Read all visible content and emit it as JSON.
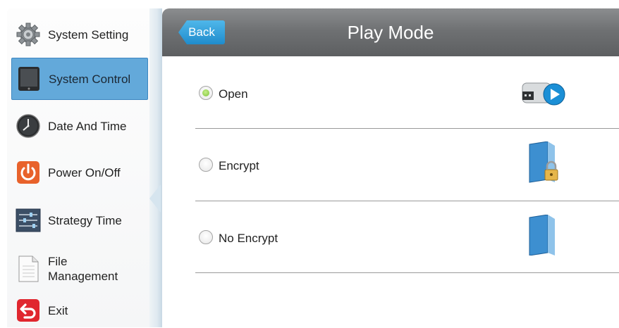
{
  "sidebar": {
    "items": [
      {
        "label": "System Setting",
        "icon": "gear-icon",
        "active": false
      },
      {
        "label": "System Control",
        "icon": "tablet-icon",
        "active": true
      },
      {
        "label": "Date And Time",
        "icon": "clock-icon",
        "active": false
      },
      {
        "label": "Power On/Off",
        "icon": "power-icon",
        "active": false
      },
      {
        "label": "Strategy Time",
        "icon": "sliders-icon",
        "active": false
      },
      {
        "label_line1": "File",
        "label_line2": "Management",
        "icon": "document-icon",
        "active": false
      },
      {
        "label": "Exit",
        "icon": "exit-icon",
        "active": false
      }
    ]
  },
  "header": {
    "back_label": "Back",
    "title": "Play Mode"
  },
  "options": [
    {
      "label": "Open",
      "selected": true,
      "icon": "usb-play-icon"
    },
    {
      "label": "Encrypt",
      "selected": false,
      "icon": "locked-folder-icon"
    },
    {
      "label": "No Encrypt",
      "selected": false,
      "icon": "folder-icon"
    }
  ],
  "colors": {
    "header_gray": "#6f7173",
    "back_blue": "#1f8ccc",
    "active_item_blue": "#63a9da",
    "radio_green": "#7cc238"
  }
}
